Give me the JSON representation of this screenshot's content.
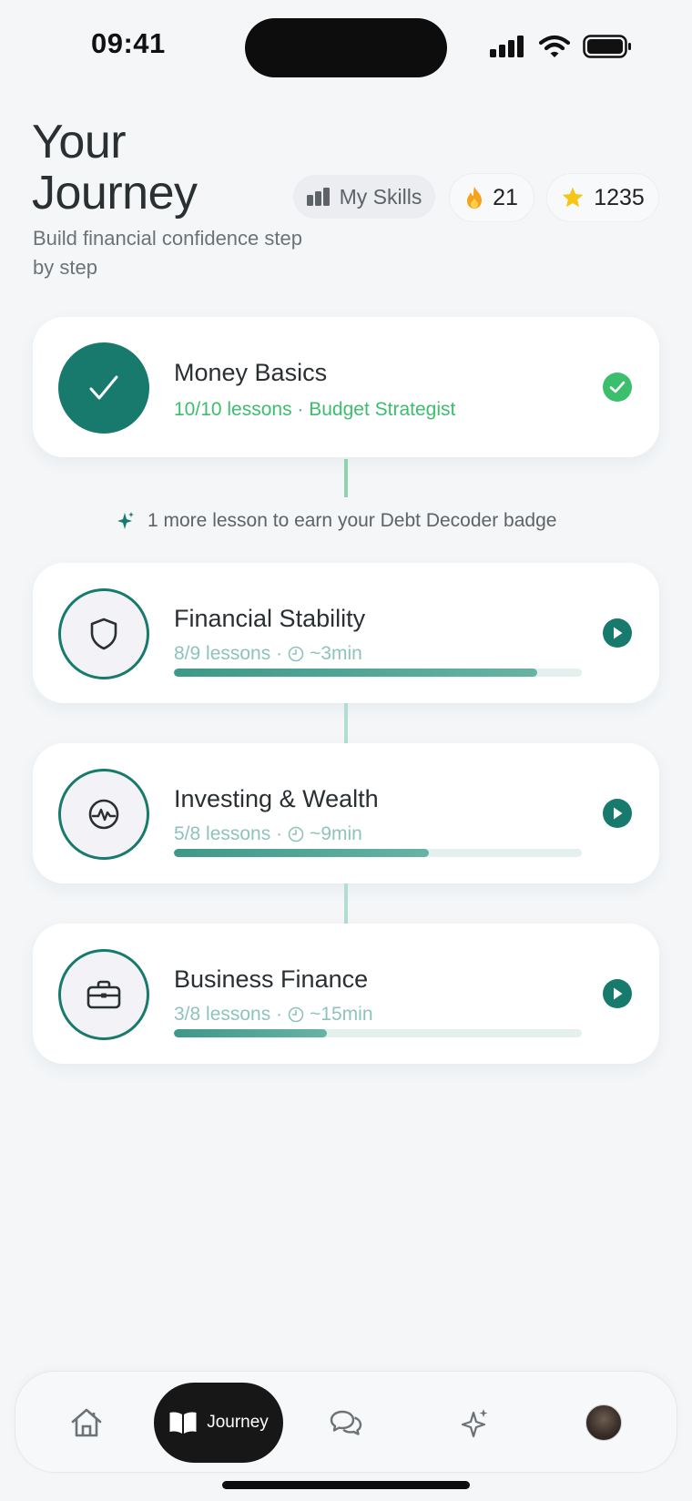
{
  "status_bar": {
    "time": "09:41"
  },
  "header": {
    "title": "Your Journey",
    "subtitle": "Build financial confidence step by step"
  },
  "chips": {
    "skills_label": "My Skills",
    "streak": "21",
    "points": "1235"
  },
  "hint": {
    "text": "1 more lesson to earn your Debt Decoder badge"
  },
  "modules": [
    {
      "title": "Money Basics",
      "meta": "10/10 lessons · Budget Strategist",
      "icon": "check-icon",
      "status": "completed"
    },
    {
      "title": "Financial Stability",
      "lessons": "8/9 lessons ·",
      "duration": "~3min",
      "icon": "shield-icon",
      "progress": 0.89
    },
    {
      "title": "Investing & Wealth",
      "lessons": "5/8 lessons ·",
      "duration": "~9min",
      "icon": "chart-icon",
      "progress": 0.625
    },
    {
      "title": "Business Finance",
      "lessons": "3/8 lessons ·",
      "duration": "~15min",
      "icon": "briefcase-icon",
      "progress": 0.375
    }
  ],
  "nav": {
    "items": [
      "home-icon",
      "journey",
      "chat-icon",
      "sparkle-icon",
      "avatar"
    ],
    "active_label": "Journey"
  },
  "colors": {
    "accent": "#177a6c",
    "success": "#3cbf6c",
    "progress": "#4fa596"
  }
}
